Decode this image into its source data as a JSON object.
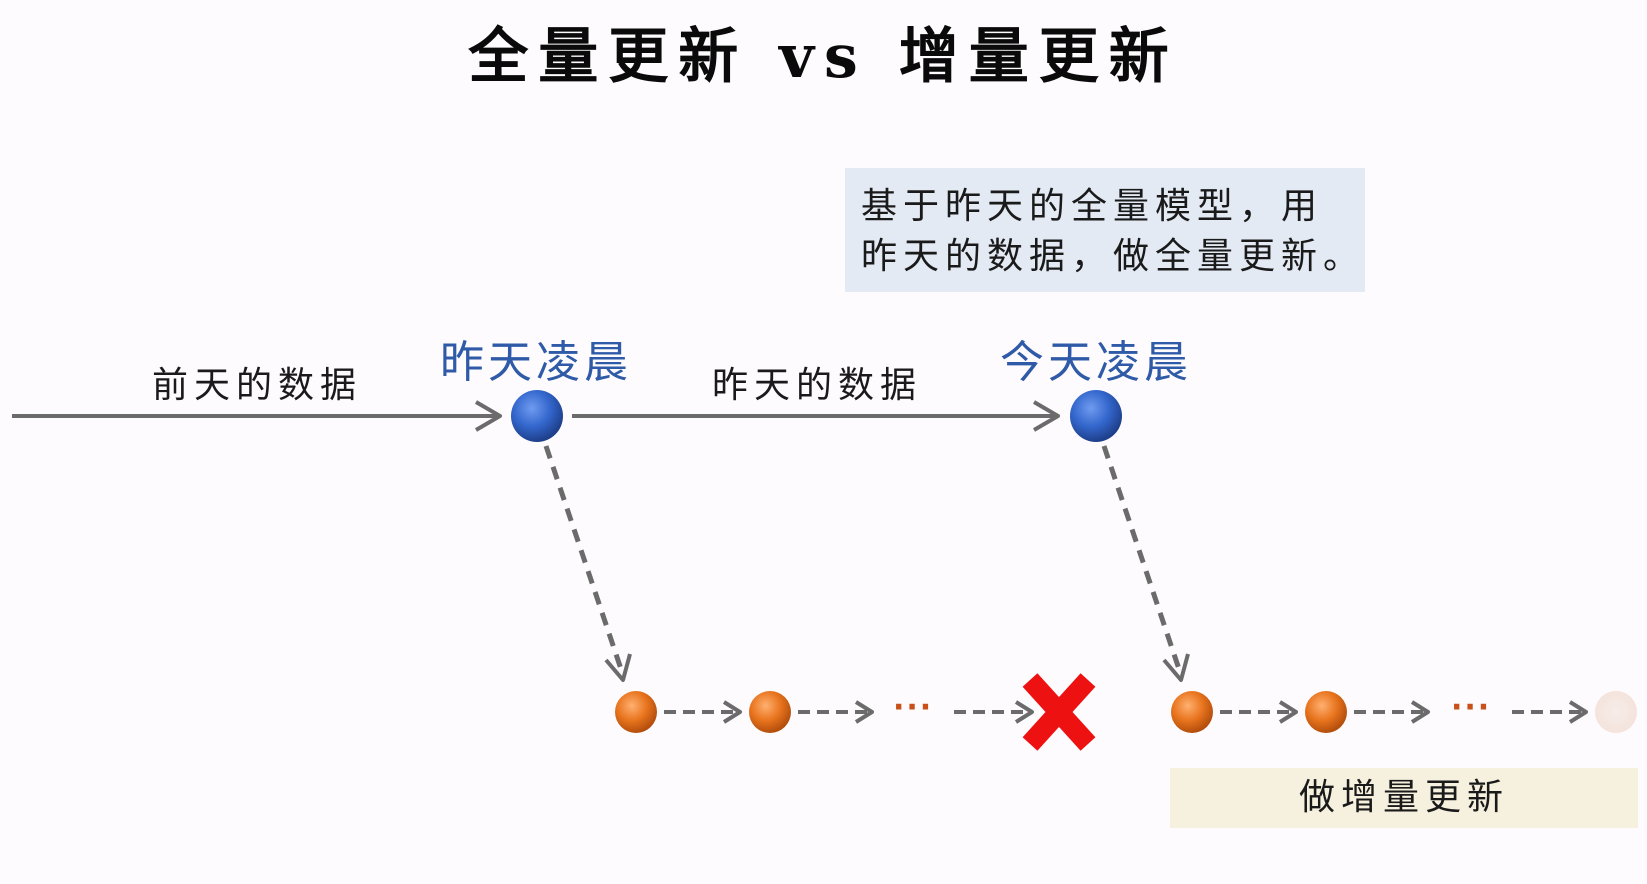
{
  "title": "全量更新 vs 增量更新",
  "callout": {
    "line1": "基于昨天的全量模型，用",
    "line2": "昨天的数据，做全量更新。"
  },
  "timeline": {
    "node1_label": "昨天凌晨",
    "node2_label": "今天凌晨",
    "segment1_label": "前天的数据",
    "segment2_label": "昨天的数据"
  },
  "incremental": {
    "ellipsis": "···",
    "box_label": "做增量更新"
  },
  "colors": {
    "node_blue": "#3366cc",
    "node_orange": "#e8741e",
    "cross_red": "#ee1111",
    "arrow_gray": "#6b6b6b",
    "time_label_blue": "#2f5aa8",
    "callout_bg": "#e3eaf4",
    "incr_box_bg": "#f6f1de"
  },
  "icons": {
    "fail_mark": "red-cross-icon"
  }
}
